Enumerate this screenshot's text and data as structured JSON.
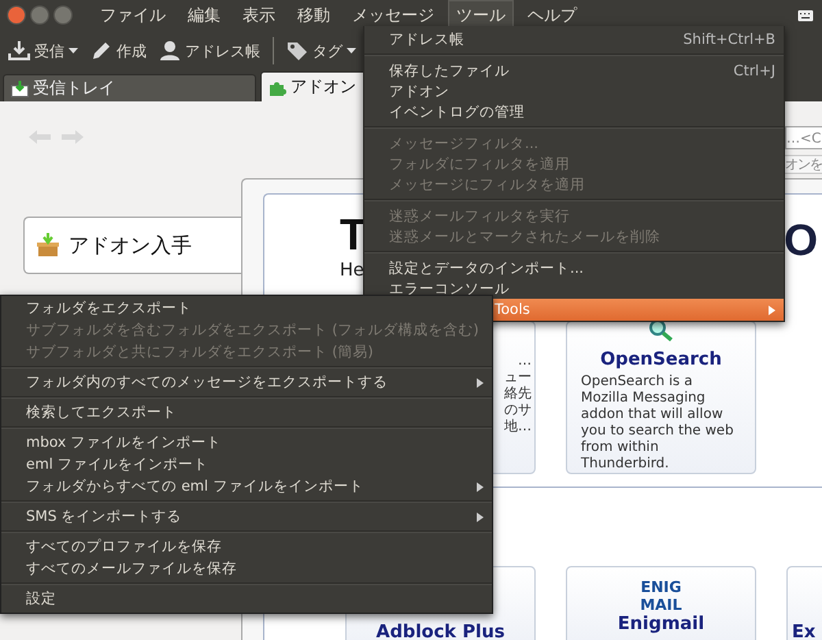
{
  "window": {
    "menubar": [
      {
        "label": "ファイル",
        "selected": false
      },
      {
        "label": "編集",
        "selected": false
      },
      {
        "label": "表示",
        "selected": false
      },
      {
        "label": "移動",
        "selected": false
      },
      {
        "label": "メッセージ",
        "selected": false
      },
      {
        "label": "ツール",
        "selected": true
      },
      {
        "label": "ヘルプ",
        "selected": false
      }
    ]
  },
  "toolbar": [
    {
      "label": "受信",
      "kind": "download",
      "dropdown": true
    },
    {
      "label": "作成",
      "kind": "pencil",
      "dropdown": false
    },
    {
      "label": "アドレス帳",
      "kind": "person",
      "dropdown": false
    },
    {
      "label": "タグ",
      "kind": "tag",
      "dropdown": true
    }
  ],
  "tabs": [
    {
      "label": "受信トレイ",
      "kind": "inbox",
      "selected": false
    },
    {
      "label": "アドオン",
      "kind": "addons",
      "selected": true
    }
  ],
  "addons_page": {
    "search": {
      "value": "…<C"
    },
    "filter": {
      "value": "オンを"
    },
    "get_addons": "アドオン入手",
    "header_title": "T",
    "header_subtitle": "He",
    "side_title": "O",
    "rows": [
      {
        "cards": [
          {
            "kind": "fragment",
            "lines": [
              "…",
              "ュー",
              "絡先",
              "のサ",
              "地…"
            ]
          },
          {
            "kind": "search",
            "title": "OpenSearch",
            "description": "OpenSearch is a Mozilla Messaging addon that will allow you to search the web from within Thunderbird."
          }
        ]
      },
      {
        "cards": [
          {
            "kind": "plain",
            "title": "Adblock Plus"
          },
          {
            "kind": "logo",
            "logo_lines": [
              "ENIG",
              "MAIL"
            ],
            "title": "Enigmail"
          },
          {
            "kind": "cut",
            "title": "Ex"
          }
        ]
      }
    ]
  },
  "tools_menu": {
    "groups": [
      [
        {
          "label": "アドレス帳",
          "shortcut": "Shift+Ctrl+B",
          "disabled": false,
          "highlighted": false,
          "has_submenu": false
        }
      ],
      [
        {
          "label": "保存したファイル",
          "shortcut": "Ctrl+J",
          "disabled": false,
          "highlighted": false,
          "has_submenu": false
        },
        {
          "label": "アドオン",
          "disabled": false,
          "highlighted": false,
          "has_submenu": false
        },
        {
          "label": "イベントログの管理",
          "disabled": false,
          "highlighted": false,
          "has_submenu": false
        }
      ],
      [
        {
          "label": "メッセージフィルタ...",
          "disabled": true,
          "highlighted": false,
          "has_submenu": false
        },
        {
          "label": "フォルダにフィルタを適用",
          "disabled": true,
          "highlighted": false,
          "has_submenu": false
        },
        {
          "label": "メッセージにフィルタを適用",
          "disabled": true,
          "highlighted": false,
          "has_submenu": false
        }
      ],
      [
        {
          "label": "迷惑メールフィルタを実行",
          "disabled": true,
          "highlighted": false,
          "has_submenu": false
        },
        {
          "label": "迷惑メールとマークされたメールを削除",
          "disabled": true,
          "highlighted": false,
          "has_submenu": false
        }
      ],
      [
        {
          "label": "設定とデータのインポート...",
          "disabled": false,
          "highlighted": false,
          "has_submenu": false
        },
        {
          "label": "エラーコンソール",
          "disabled": false,
          "highlighted": false,
          "has_submenu": false
        },
        {
          "label": "Tools",
          "kind": "partial",
          "disabled": false,
          "highlighted": true,
          "has_submenu": true
        }
      ]
    ]
  },
  "submenu": {
    "groups": [
      [
        {
          "label": "フォルダをエクスポート",
          "disabled": false,
          "has_submenu": false
        },
        {
          "label": "サブフォルダを含むフォルダをエクスポート (フォルダ構成を含む)",
          "disabled": true,
          "has_submenu": false
        },
        {
          "label": "サブフォルダと共にフォルダをエクスポート (簡易)",
          "disabled": true,
          "has_submenu": false
        }
      ],
      [
        {
          "label": "フォルダ内のすべてのメッセージをエクスポートする",
          "disabled": false,
          "has_submenu": true
        }
      ],
      [
        {
          "label": "検索してエクスポート",
          "disabled": false,
          "has_submenu": false
        }
      ],
      [
        {
          "label": "mbox ファイルをインポート",
          "disabled": false,
          "has_submenu": false
        },
        {
          "label": "eml ファイルをインポート",
          "disabled": false,
          "has_submenu": false
        },
        {
          "label": "フォルダからすべての eml ファイルをインポート",
          "disabled": false,
          "has_submenu": true
        }
      ],
      [
        {
          "label": "SMS をインポートする",
          "disabled": false,
          "has_submenu": true
        }
      ],
      [
        {
          "label": "すべてのプロファイルを保存",
          "disabled": false,
          "has_submenu": false
        },
        {
          "label": "すべてのメールファイルを保存",
          "disabled": false,
          "has_submenu": false
        }
      ],
      [
        {
          "label": "設定",
          "disabled": false,
          "has_submenu": false
        }
      ]
    ]
  }
}
